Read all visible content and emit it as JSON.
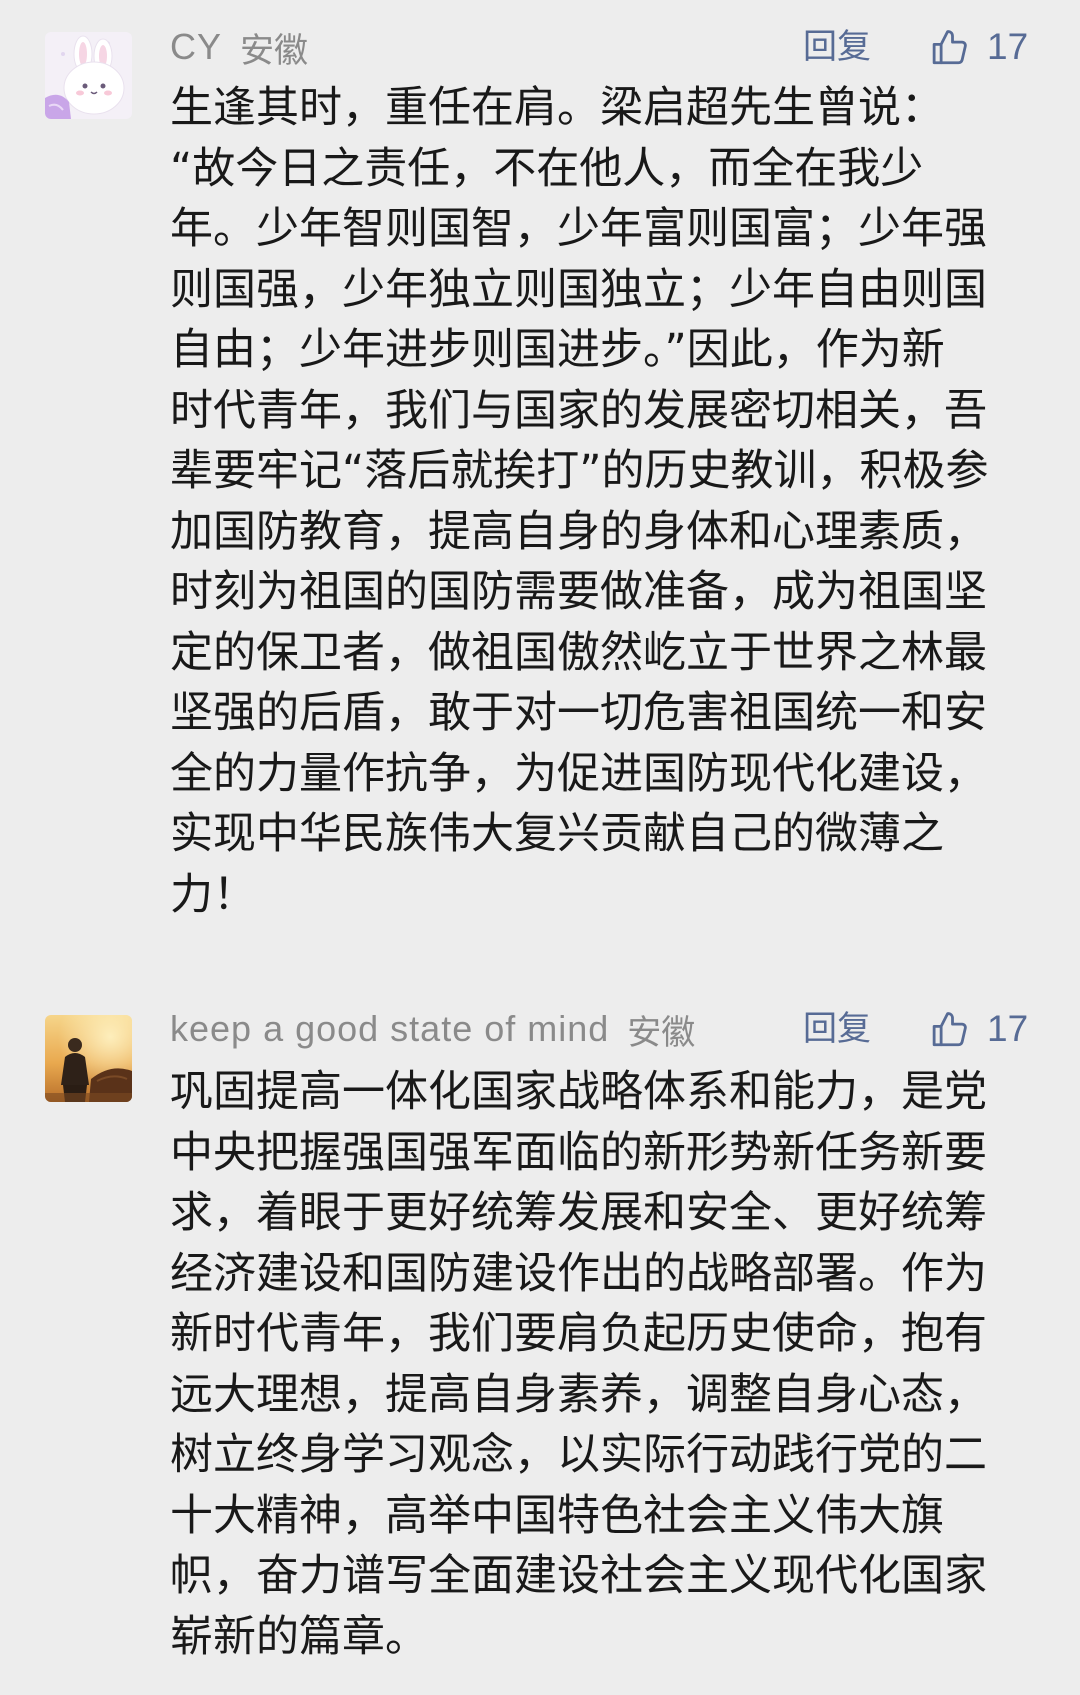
{
  "colors": {
    "background": "#ededed",
    "text": "#191919",
    "meta": "#8a8a8a",
    "link": "#576b95"
  },
  "icons": {
    "like": "thumbs-up-icon",
    "avatar_1": "bunny-avatar-icon",
    "avatar_2": "photo-avatar"
  },
  "comments": [
    {
      "author": "CY",
      "location": "安徽",
      "reply_label": "回复",
      "like_count": "17",
      "body_lines": [
        "生逢其时，重任在肩。梁启超先生曾说：",
        "“故今日之责任，不在他人，而全在我少",
        "年。少年智则国智，少年富则国富；少年强",
        "则国强，少年独立则国独立；少年自由则国",
        "自由；少年进步则国进步。”因此，作为新",
        "时代青年，我们与国家的发展密切相关，吾",
        "辈要牢记“落后就挨打”的历史教训，积极参",
        "加国防教育，提高自身的身体和心理素质，",
        "时刻为祖国的国防需要做准备，成为祖国坚",
        "定的保卫者，做祖国傲然屹立于世界之林最",
        "坚强的后盾，敢于对一切危害祖国统一和安",
        "全的力量作抗争，为促进国防现代化建设，",
        "实现中华民族伟大复兴贡献自己的微薄之",
        "力！"
      ]
    },
    {
      "author": "keep a good state of mind",
      "location": "安徽",
      "reply_label": "回复",
      "like_count": "17",
      "body_lines": [
        "巩固提高一体化国家战略体系和能力，是党",
        "中央把握强国强军面临的新形势新任务新要",
        "求，着眼于更好统筹发展和安全、更好统筹",
        "经济建设和国防建设作出的战略部署。作为",
        "新时代青年，我们要肩负起历史使命，抱有",
        "远大理想，提高自身素养，调整自身心态，",
        "树立终身学习观念，以实际行动践行党的二",
        "十大精神，高举中国特色社会主义伟大旗",
        "帜，奋力谱写全面建设社会主义现代化国家",
        "崭新的篇章。"
      ]
    }
  ]
}
